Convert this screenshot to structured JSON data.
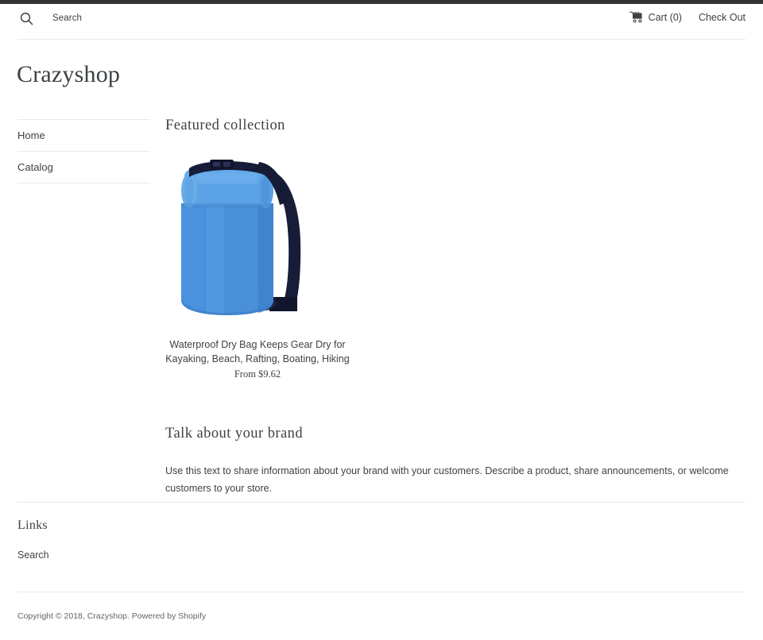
{
  "theme": {
    "top_strip_color": "#333333",
    "text_color": "#3d4246",
    "rule_color": "#e8e9ea",
    "bag_blue": "#4a90d9",
    "bag_blue_dark": "#3a7dc4",
    "bag_blue_light": "#6aa9e4",
    "strap_navy": "#161b35"
  },
  "header": {
    "search_icon": "search-icon",
    "search_label": "Search",
    "search_placeholder": "Search",
    "cart_icon": "shopping-cart-icon",
    "cart_label": "Cart (0)",
    "cart_count": 0,
    "checkout_label": "Check Out"
  },
  "shop": {
    "title": "Crazyshop"
  },
  "sidebar": {
    "items": [
      {
        "label": "Home"
      },
      {
        "label": "Catalog"
      }
    ]
  },
  "main": {
    "featured": {
      "title": "Featured collection",
      "products": [
        {
          "image_alt": "blue-waterproof-dry-bag",
          "title": "Waterproof Dry Bag Keeps Gear Dry for Kayaking, Beach, Rafting, Boating, Hiking",
          "price": "From $9.62"
        }
      ]
    },
    "brand": {
      "title": "Talk about your brand",
      "text": "Use this text to share information about your brand with your customers. Describe a product, share announcements, or welcome customers to your store."
    }
  },
  "footer": {
    "links_heading": "Links",
    "links": [
      {
        "label": "Search"
      }
    ],
    "copyright_prefix": "Copyright © 2018, ",
    "copyright_shop": "Crazyshop",
    "copyright_mid": ". Powered by ",
    "copyright_platform": "Shopify"
  }
}
